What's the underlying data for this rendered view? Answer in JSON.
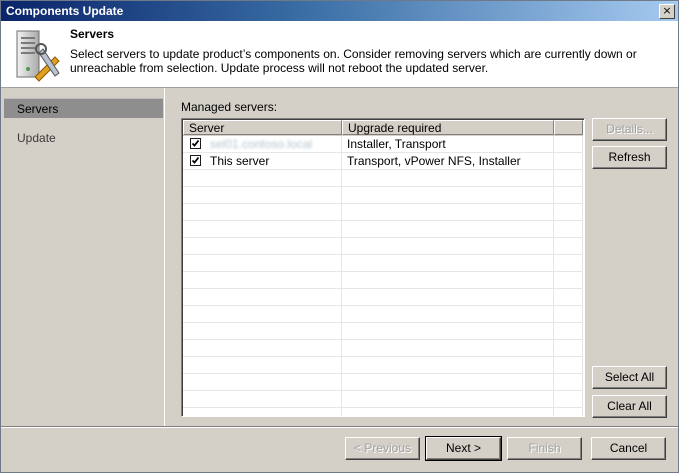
{
  "window": {
    "title": "Components Update",
    "close_glyph": "×"
  },
  "header": {
    "title": "Servers",
    "description": "Select servers to update product’s components on. Consider removing servers which are currently down or unreachable from selection. Update process will not reboot the updated server.",
    "icon": "server-tools-icon"
  },
  "sidebar": {
    "items": [
      {
        "label": "Servers",
        "active": true
      },
      {
        "label": "Update",
        "active": false
      }
    ]
  },
  "main": {
    "managed_label": "Managed servers:",
    "columns": [
      "Server",
      "Upgrade required"
    ],
    "rows": [
      {
        "checked": true,
        "server": "sel01.contoso.local",
        "server_obscured": true,
        "upgrade": "Installer, Transport"
      },
      {
        "checked": true,
        "server": "This server",
        "server_obscured": false,
        "upgrade": "Transport, vPower NFS, Installer"
      }
    ]
  },
  "side_buttons": {
    "details": "Details...",
    "refresh": "Refresh",
    "select_all": "Select All",
    "clear_all": "Clear All"
  },
  "footer": {
    "previous": "< Previous",
    "next": "Next >",
    "finish": "Finish",
    "cancel": "Cancel"
  },
  "colors": {
    "title_gradient_start": "#0a246a",
    "title_gradient_end": "#a6caf0",
    "dialog_bg": "#d4d0c8",
    "active_nav": "#8e8e8e"
  }
}
